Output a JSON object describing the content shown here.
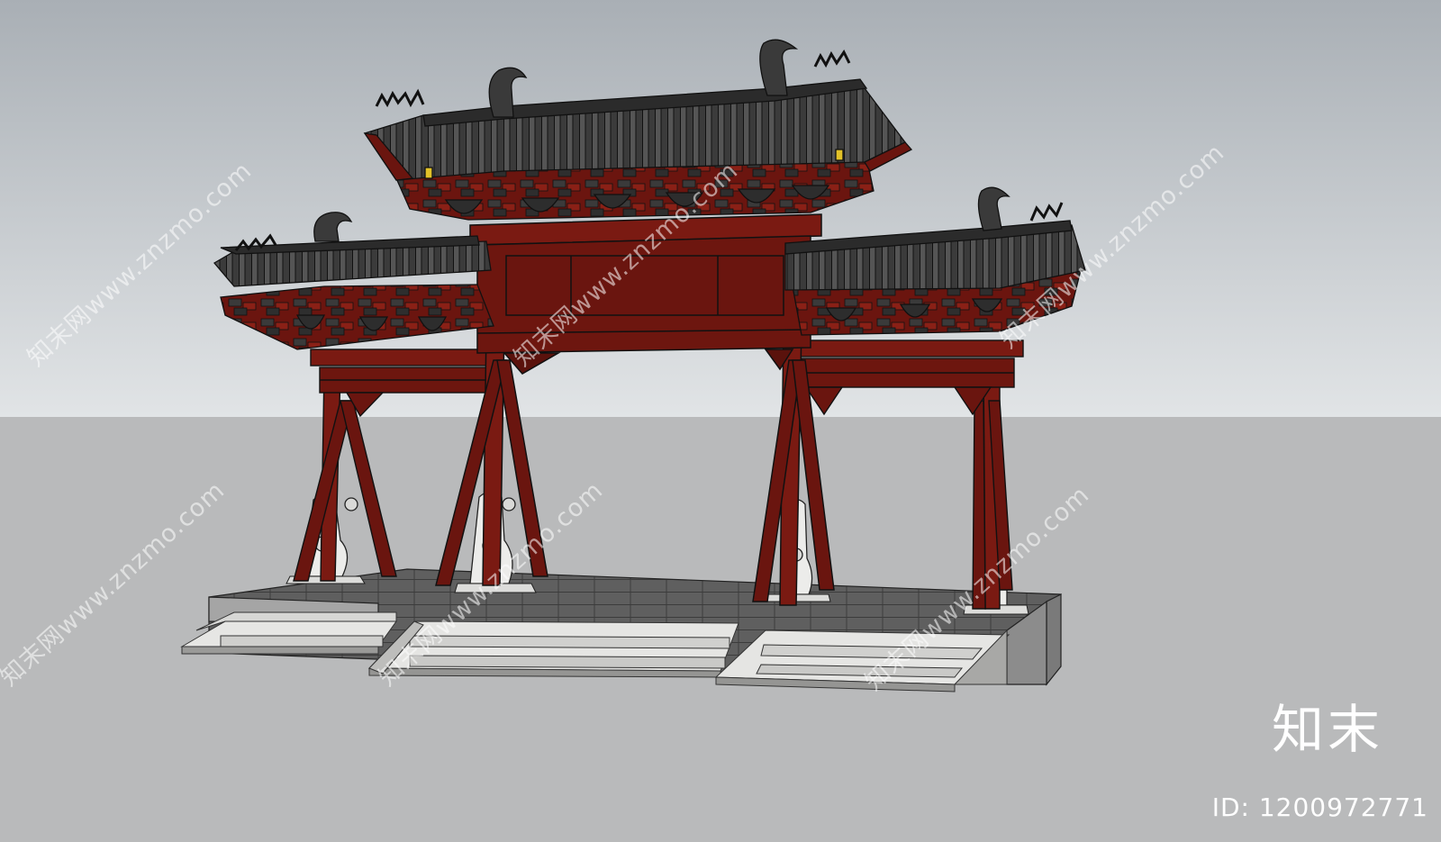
{
  "colors": {
    "sky_top": "#a9afb5",
    "sky_bottom": "#dfe2e4",
    "ground": "#b9babb",
    "timber_red": "#7a1a12",
    "timber_dark": "#5a120c",
    "roof_tile": "#3a3a3a",
    "stone_light": "#e8e8e6",
    "stone_mid": "#b4b4b2",
    "stone_dark": "#6d6d6d"
  },
  "watermark": {
    "site_text": "知末网www.znzmo.com",
    "brand": "知末",
    "id_text": "ID: 1200972771"
  }
}
